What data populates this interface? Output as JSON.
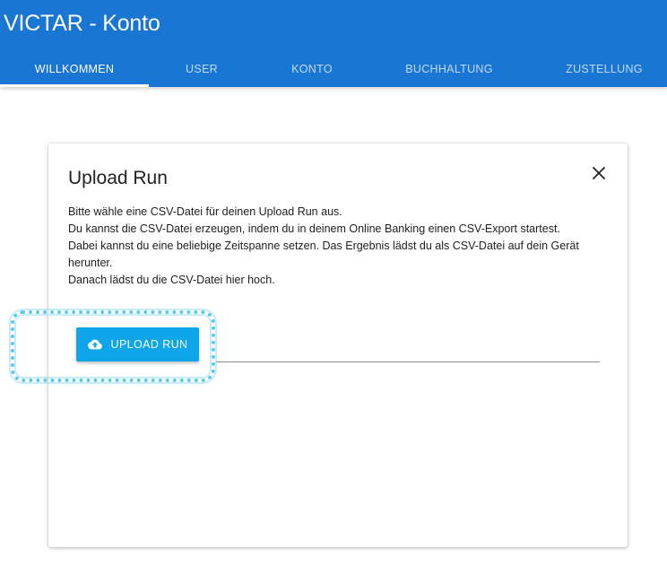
{
  "app": {
    "title": "VICTAR - Konto"
  },
  "tabs": [
    {
      "label": "WILLKOMMEN",
      "active": true
    },
    {
      "label": "USER",
      "active": false
    },
    {
      "label": "KONTO",
      "active": false
    },
    {
      "label": "BUCHHALTUNG",
      "active": false
    },
    {
      "label": "ZUSTELLUNG",
      "active": false
    }
  ],
  "dialog": {
    "title": "Upload Run",
    "close_icon": "close-icon",
    "text_lines": [
      "Bitte wähle eine CSV-Datei für deinen Upload Run aus.",
      "Du kannst die CSV-Datei erzeugen, indem du in deinem Online Banking einen CSV-Export startest.",
      "Dabei kannst du eine beliebige Zeitspanne setzen. Das Ergebnis lädst du als CSV-Datei auf dein Gerät",
      "herunter.",
      "Danach lädst du die CSV-Datei hier hoch."
    ],
    "upload_button": {
      "label": "UPLOAD RUN",
      "icon": "cloud-upload-icon"
    }
  },
  "colors": {
    "appbar": "#1976d2",
    "button": "#0ea5ea",
    "highlight": "#5cc8f0"
  }
}
